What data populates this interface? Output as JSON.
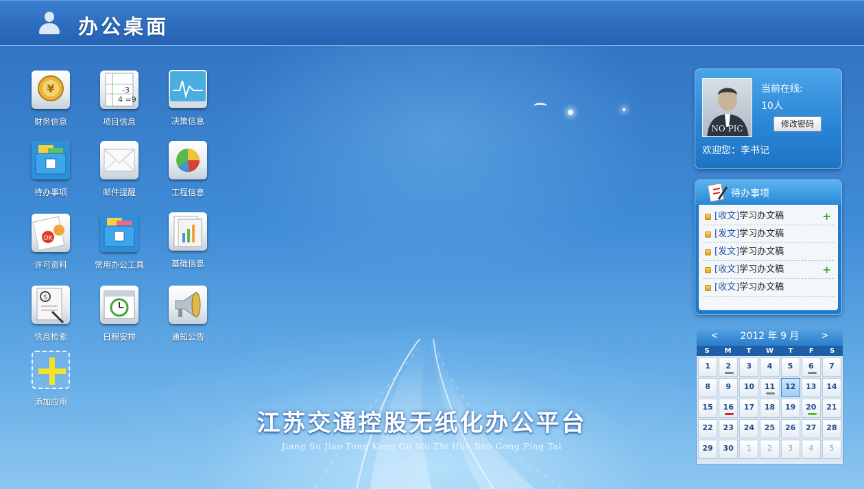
{
  "header": {
    "title": "办公桌面"
  },
  "apps": [
    {
      "label": "财务信息",
      "icon": "finance-coin-icon"
    },
    {
      "label": "项目信息",
      "icon": "calculator-icon"
    },
    {
      "label": "决策信息",
      "icon": "monitor-chart-icon"
    },
    {
      "label": "待办事项",
      "icon": "todo-folder-icon"
    },
    {
      "label": "邮件提醒",
      "icon": "mail-envelope-icon"
    },
    {
      "label": "工程信息",
      "icon": "pie-chart-icon"
    },
    {
      "label": "许可资料",
      "icon": "permit-document-icon"
    },
    {
      "label": "常用办公工具",
      "icon": "toolbox-folder-icon"
    },
    {
      "label": "基础信息",
      "icon": "report-document-icon"
    },
    {
      "label": "信息检索",
      "icon": "search-document-icon"
    },
    {
      "label": "日程安排",
      "icon": "calendar-clock-icon"
    },
    {
      "label": "通知公告",
      "icon": "megaphone-icon"
    },
    {
      "label": "添加应用",
      "icon": "add-plus-icon"
    }
  ],
  "banner": {
    "title_cn": "江苏交通控股无纸化办公平台",
    "title_en": "Jiang Su Jiao Tong Kong Gu Wu Zhi Hua Ban Gong Ping Tai"
  },
  "user_panel": {
    "avatar_label": "NO PIC",
    "online_label": "当前在线:",
    "online_count": "10人",
    "change_password": "修改密码",
    "welcome": "欢迎您：李书记"
  },
  "todo": {
    "title": "待办事项",
    "items": [
      {
        "tag": "[收文]",
        "text": "学习办文稿",
        "has_plus": true
      },
      {
        "tag": "[发文]",
        "text": "学习办文稿",
        "has_plus": false
      },
      {
        "tag": "[发文]",
        "text": "学习办文稿",
        "has_plus": false
      },
      {
        "tag": "[收文]",
        "text": "学习办文稿",
        "has_plus": true
      },
      {
        "tag": "[收文]",
        "text": "学习办文稿",
        "has_plus": false
      }
    ]
  },
  "calendar": {
    "title": "2012 年 9 月",
    "prev": "<",
    "next": ">",
    "weekdays": [
      "S",
      "M",
      "T",
      "W",
      "T",
      "F",
      "S"
    ],
    "today": "12",
    "days": [
      {
        "d": "1"
      },
      {
        "d": "2",
        "mark": "#7f7f7f"
      },
      {
        "d": "3"
      },
      {
        "d": "4"
      },
      {
        "d": "5"
      },
      {
        "d": "6",
        "mark": "#7f7f7f"
      },
      {
        "d": "7"
      },
      {
        "d": "8"
      },
      {
        "d": "9"
      },
      {
        "d": "10"
      },
      {
        "d": "11",
        "mark": "#7f7f7f"
      },
      {
        "d": "12"
      },
      {
        "d": "13"
      },
      {
        "d": "14"
      },
      {
        "d": "15"
      },
      {
        "d": "16",
        "mark": "#d8203a"
      },
      {
        "d": "17"
      },
      {
        "d": "18"
      },
      {
        "d": "19"
      },
      {
        "d": "20",
        "mark": "#5ab82e"
      },
      {
        "d": "21"
      },
      {
        "d": "22"
      },
      {
        "d": "23"
      },
      {
        "d": "24"
      },
      {
        "d": "25"
      },
      {
        "d": "26"
      },
      {
        "d": "27"
      },
      {
        "d": "28"
      },
      {
        "d": "29"
      },
      {
        "d": "30"
      },
      {
        "d": "1",
        "other": true
      },
      {
        "d": "2",
        "other": true
      },
      {
        "d": "3",
        "other": true
      },
      {
        "d": "4",
        "other": true
      },
      {
        "d": "5",
        "other": true
      }
    ]
  }
}
